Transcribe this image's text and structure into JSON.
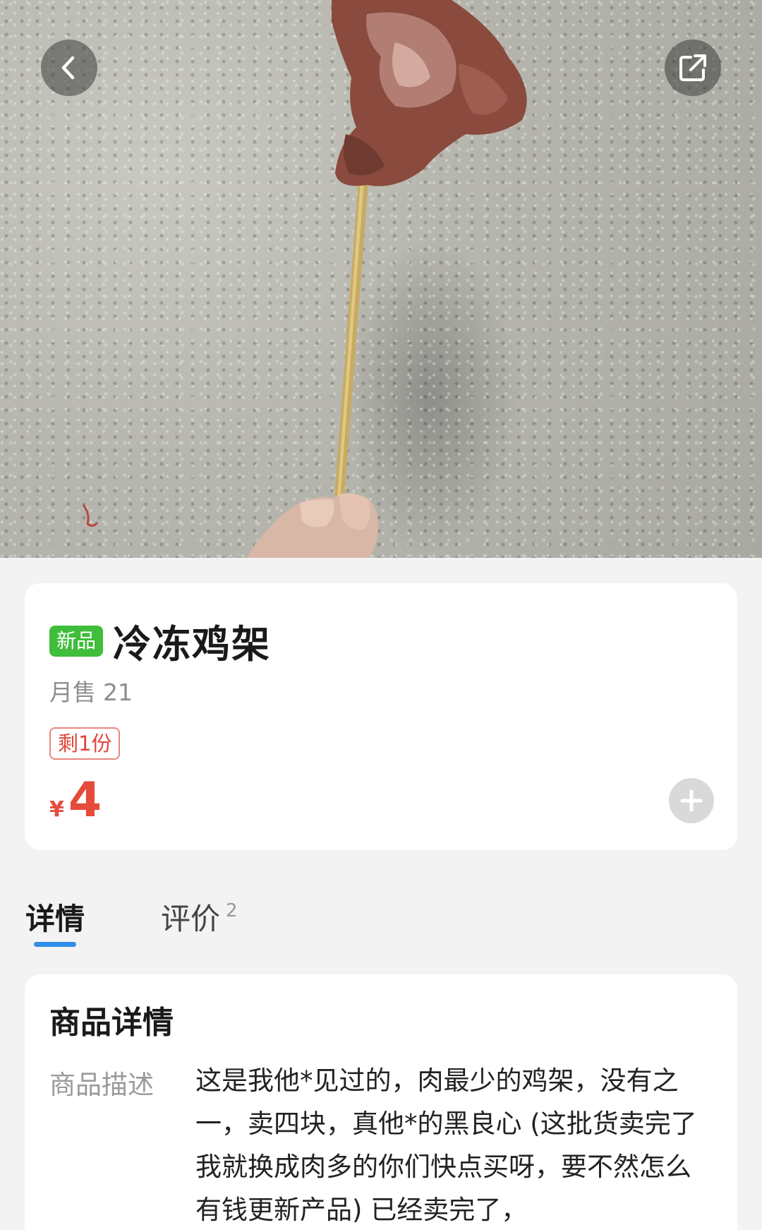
{
  "header": {
    "back_icon": "chevron-left-icon",
    "share_icon": "share-external-icon"
  },
  "product": {
    "badge": "新品",
    "title": "冷冻鸡架",
    "sales_label": "月售",
    "sales_count": "21",
    "stock_label": "剩1份",
    "currency": "¥",
    "price": "4",
    "add_icon": "plus-icon"
  },
  "tabs": [
    {
      "label": "详情",
      "active": true
    },
    {
      "label": "评价",
      "count": "2",
      "active": false
    }
  ],
  "details": {
    "heading": "商品详情",
    "description_label": "商品描述",
    "description_text": "这是我他*见过的，肉最少的鸡架，没有之一，卖四块，真他*的黑良心 (这批货卖完了我就换成肉多的你们快点买呀，要不然怎么有钱更新产品) 已经卖完了，"
  },
  "colors": {
    "accent_blue": "#2f8fe8",
    "price_red": "#e64a3a",
    "new_badge_green": "#3fbd3b"
  }
}
